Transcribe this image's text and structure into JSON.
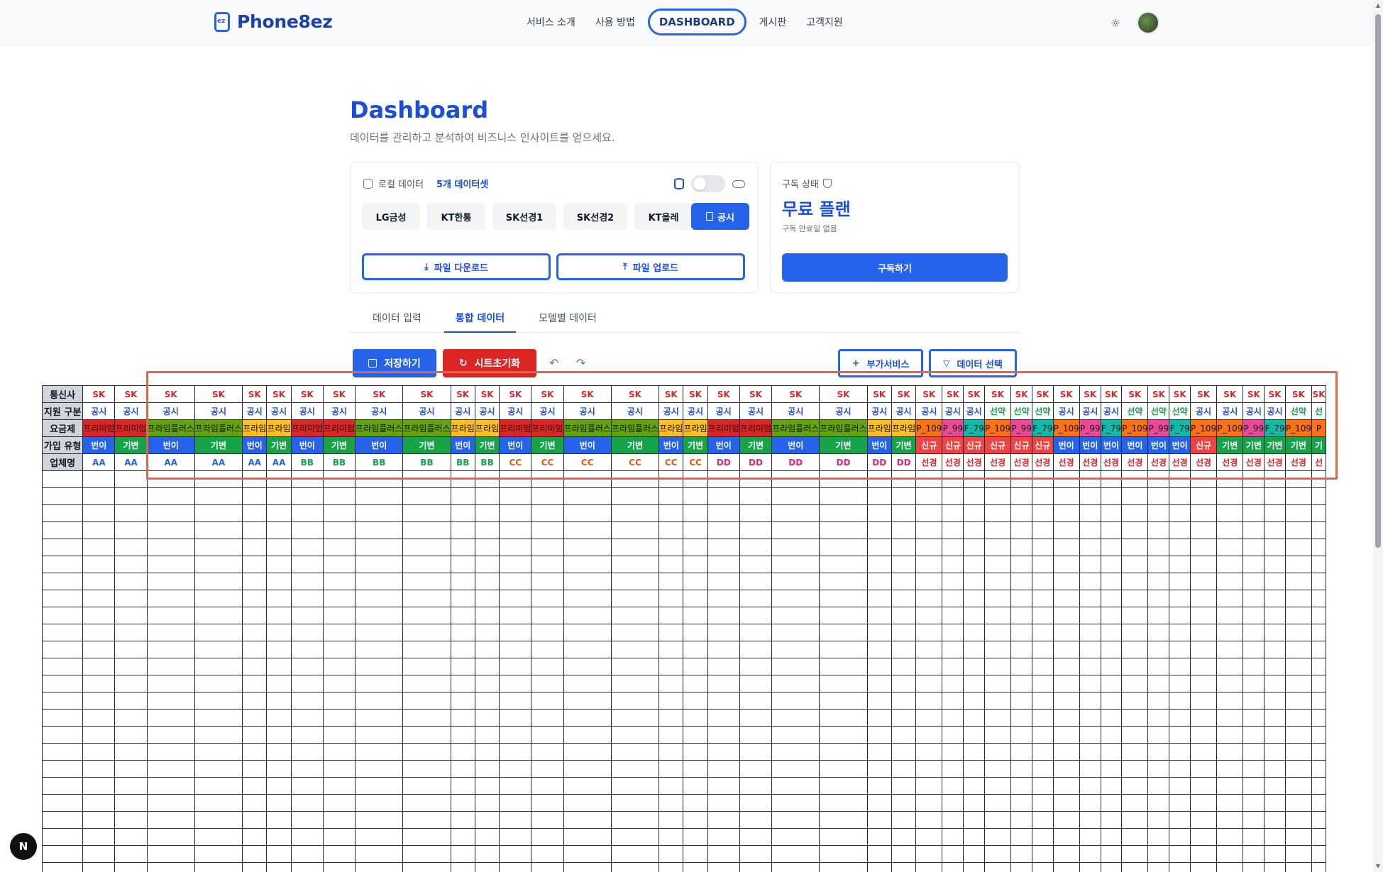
{
  "app": {
    "logo_text": "Phone8ez",
    "logo_mark": "ez",
    "nav": [
      "서비스 소개",
      "사용 방법",
      "DASHBOARD",
      "게시판",
      "고객지원"
    ],
    "active_nav": "DASHBOARD",
    "theme_icon": "sun-icon",
    "avatar_icon": "avatar"
  },
  "page": {
    "title": "Dashboard",
    "subtitle": "데이터를 관리하고 분석하여 비즈니스 인사이트를 얻으세요."
  },
  "local_data": {
    "label": "로컬 데이터",
    "count": "5개 데이터셋",
    "datasets": [
      "LG금성",
      "KT한통",
      "SK선경1",
      "SK선경2",
      "KT올레"
    ],
    "active_dataset": "공시",
    "download_label": "파일 다운로드",
    "upload_label": "파일 업로드"
  },
  "subscription": {
    "label": "구독 상태",
    "plan": "무료 플랜",
    "expiry": "구독 만료일 없음",
    "button": "구독하기"
  },
  "tabs": [
    "데이터 입력",
    "통합 데이터",
    "모델별 데이터"
  ],
  "active_tab": "통합 데이터",
  "toolbar": {
    "save": "저장하기",
    "reset": "시트초기화",
    "addon": "부가서비스",
    "select": "데이터 선택"
  },
  "sheet": {
    "row_headers": [
      "통신사",
      "지원 구분",
      "요금제",
      "가입 유형",
      "업체명"
    ],
    "columns": [
      {
        "carrier": "SK",
        "support": "공시",
        "plan": "프리미엄",
        "join": "번이",
        "vendor": "AA"
      },
      {
        "carrier": "SK",
        "support": "공시",
        "plan": "프리미엄",
        "join": "기변",
        "vendor": "AA"
      },
      {
        "carrier": "SK",
        "support": "공시",
        "plan": "프라임플러스",
        "join": "번이",
        "vendor": "AA"
      },
      {
        "carrier": "SK",
        "support": "공시",
        "plan": "프라임플러스",
        "join": "기변",
        "vendor": "AA"
      },
      {
        "carrier": "SK",
        "support": "공시",
        "plan": "프라임",
        "join": "번이",
        "vendor": "AA"
      },
      {
        "carrier": "SK",
        "support": "공시",
        "plan": "프라임",
        "join": "기변",
        "vendor": "AA"
      },
      {
        "carrier": "SK",
        "support": "공시",
        "plan": "프리미엄",
        "join": "번이",
        "vendor": "BB"
      },
      {
        "carrier": "SK",
        "support": "공시",
        "plan": "프리미엄",
        "join": "기변",
        "vendor": "BB"
      },
      {
        "carrier": "SK",
        "support": "공시",
        "plan": "프라임플러스",
        "join": "번이",
        "vendor": "BB"
      },
      {
        "carrier": "SK",
        "support": "공시",
        "plan": "프라임플러스",
        "join": "기변",
        "vendor": "BB"
      },
      {
        "carrier": "SK",
        "support": "공시",
        "plan": "프라임",
        "join": "번이",
        "vendor": "BB"
      },
      {
        "carrier": "SK",
        "support": "공시",
        "plan": "프라임",
        "join": "기변",
        "vendor": "BB"
      },
      {
        "carrier": "SK",
        "support": "공시",
        "plan": "프리미엄",
        "join": "번이",
        "vendor": "CC"
      },
      {
        "carrier": "SK",
        "support": "공시",
        "plan": "프리미엄",
        "join": "기변",
        "vendor": "CC"
      },
      {
        "carrier": "SK",
        "support": "공시",
        "plan": "프라임플러스",
        "join": "번이",
        "vendor": "CC"
      },
      {
        "carrier": "SK",
        "support": "공시",
        "plan": "프라임플러스",
        "join": "기변",
        "vendor": "CC"
      },
      {
        "carrier": "SK",
        "support": "공시",
        "plan": "프라임",
        "join": "번이",
        "vendor": "CC"
      },
      {
        "carrier": "SK",
        "support": "공시",
        "plan": "프라임",
        "join": "기변",
        "vendor": "CC"
      },
      {
        "carrier": "SK",
        "support": "공시",
        "plan": "프리미엄",
        "join": "번이",
        "vendor": "DD"
      },
      {
        "carrier": "SK",
        "support": "공시",
        "plan": "프리미엄",
        "join": "기변",
        "vendor": "DD"
      },
      {
        "carrier": "SK",
        "support": "공시",
        "plan": "프라임플러스",
        "join": "번이",
        "vendor": "DD"
      },
      {
        "carrier": "SK",
        "support": "공시",
        "plan": "프라임플러스",
        "join": "기변",
        "vendor": "DD"
      },
      {
        "carrier": "SK",
        "support": "공시",
        "plan": "프라임",
        "join": "번이",
        "vendor": "DD"
      },
      {
        "carrier": "SK",
        "support": "공시",
        "plan": "프라임",
        "join": "기변",
        "vendor": "DD"
      },
      {
        "carrier": "SK",
        "support": "공시",
        "plan": "P_109",
        "join": "신규",
        "vendor": "선경"
      },
      {
        "carrier": "SK",
        "support": "공시",
        "plan": "P_99",
        "join": "신규",
        "vendor": "선경"
      },
      {
        "carrier": "SK",
        "support": "공시",
        "plan": "F_79",
        "join": "신규",
        "vendor": "선경"
      },
      {
        "carrier": "SK",
        "support": "선약",
        "plan": "P_109",
        "join": "신규",
        "vendor": "선경"
      },
      {
        "carrier": "SK",
        "support": "선약",
        "plan": "P_99",
        "join": "신규",
        "vendor": "선경"
      },
      {
        "carrier": "SK",
        "support": "선약",
        "plan": "F_79",
        "join": "신규",
        "vendor": "선경"
      },
      {
        "carrier": "SK",
        "support": "공시",
        "plan": "P_109",
        "join": "번이",
        "vendor": "선경"
      },
      {
        "carrier": "SK",
        "support": "공시",
        "plan": "P_99",
        "join": "번이",
        "vendor": "선경"
      },
      {
        "carrier": "SK",
        "support": "공시",
        "plan": "F_79",
        "join": "번이",
        "vendor": "선경"
      },
      {
        "carrier": "SK",
        "support": "선약",
        "plan": "P_109",
        "join": "번이",
        "vendor": "선경"
      },
      {
        "carrier": "SK",
        "support": "선약",
        "plan": "P_99",
        "join": "번이",
        "vendor": "선경"
      },
      {
        "carrier": "SK",
        "support": "선약",
        "plan": "F_79",
        "join": "번이",
        "vendor": "선경"
      },
      {
        "carrier": "SK",
        "support": "공시",
        "plan": "P_109",
        "join": "신규",
        "vendor": "선경"
      },
      {
        "carrier": "SK",
        "support": "공시",
        "plan": "P_109",
        "join": "기변",
        "vendor": "선경"
      },
      {
        "carrier": "SK",
        "support": "공시",
        "plan": "P_99",
        "join": "기변",
        "vendor": "선경"
      },
      {
        "carrier": "SK",
        "support": "공시",
        "plan": "F_79",
        "join": "기변",
        "vendor": "선경"
      },
      {
        "carrier": "SK",
        "support": "선약",
        "plan": "P_109",
        "join": "기변",
        "vendor": "선경"
      },
      {
        "carrier": "SK",
        "support": "선",
        "plan": "P",
        "join": "기",
        "vendor": "선"
      }
    ],
    "colors": {
      "carrier": "#dc2626",
      "support_public": "#1d4ed8",
      "support_contract": "#16a34a",
      "join_bg": {
        "번이": "#2563eb",
        "기변": "#16a34a",
        "신규": "#ef4444"
      },
      "plan_bg": {
        "프리미엄": "#dc2626",
        "프라임플러스": "#65a30d",
        "프라임": "#fbbf24",
        "P_109": "#f97316",
        "P_99": "#ec4899",
        "F_79": "#14b8a6"
      },
      "vendor": {
        "AA": "#2563eb",
        "BB": "#16a34a",
        "CC": "#ea580c",
        "DD": "#db2777",
        "선경": "#dc2626"
      }
    },
    "empty_rows": 24
  },
  "badge": "N"
}
